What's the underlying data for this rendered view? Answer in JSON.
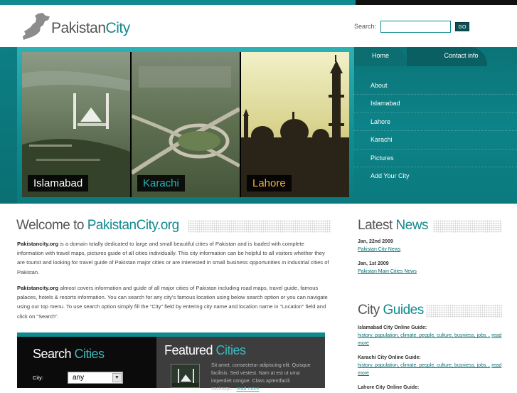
{
  "header": {
    "logo_part1": "Pakistan",
    "logo_part2": "City",
    "search_label": "Search:",
    "search_value": "",
    "go_label": "GO"
  },
  "hero": {
    "photos": [
      {
        "label": "Islamabad",
        "label_color": "#ffffff"
      },
      {
        "label": "Karachi",
        "label_color": "#23b6ba"
      },
      {
        "label": "Lahore",
        "label_color": "#f0b23c"
      }
    ]
  },
  "nav": {
    "home": "Home",
    "contact": "Contact info",
    "menu": [
      "About",
      "Islamabad",
      "Lahore",
      "Karachi",
      "Pictures",
      "Add Your City"
    ]
  },
  "welcome": {
    "title_part1": "Welcome to ",
    "title_part2": "PakistanCity.org",
    "p1_bold": "Pakistancity.org",
    "p1_text": " is a domain totally dedicated to large and small beautiful cities of Pakistan and is loaded with complete information with travel maps, pictures guide of all cities individually. This city information can be helpful to all visitors whether they are tourist and looking for travel guide of Pakistan major cities or are interested in small business opportunities in industrial cities of Pakistan.",
    "p2_bold": "Pakistancity.org",
    "p2_text": " almost covers information and guide of all major cities of Pakistan including road maps, travel guide, famous palaces, hotels & resorts information. You can search for any city’s famous location using below search option or you can navigate using our top menu.  To use search option simply fill the “City” field by entering city name and location name in “Location” field and click on “Search”."
  },
  "latest_news": {
    "title_part1": "Latest ",
    "title_part2": "News",
    "items": [
      {
        "date": "Jan, 22nd 2009",
        "link": "Pakistan City News"
      },
      {
        "date": "Jan, 1st 2009",
        "link": "Pakistan Main Cities News"
      }
    ]
  },
  "city_guides": {
    "title_part1": "City ",
    "title_part2": "Guides",
    "items": [
      {
        "title": "Islamabad City Online Guide:",
        "link": "history, population, climate, people, culture, busniess, jobs...",
        "more": "read more"
      },
      {
        "title": "Karachi City Online Guide:",
        "link": "history, population, climate, people, culture, busniess, jobs...",
        "more": "read more"
      },
      {
        "title": "Lahore City Online Guide:"
      }
    ]
  },
  "search_cities": {
    "title_part1": "Search ",
    "title_part2": "Cities",
    "city_label": "City:",
    "city_value": "any"
  },
  "featured": {
    "title_part1": "Featured ",
    "title_part2": "Cities",
    "text": "Sit amet, consectetur adipiscing elit. Quisque facilisis. Sed vestest. Nam at est ut urna imperdiet congue. Class aptentfacili sociosqu...",
    "more": "read more"
  }
}
